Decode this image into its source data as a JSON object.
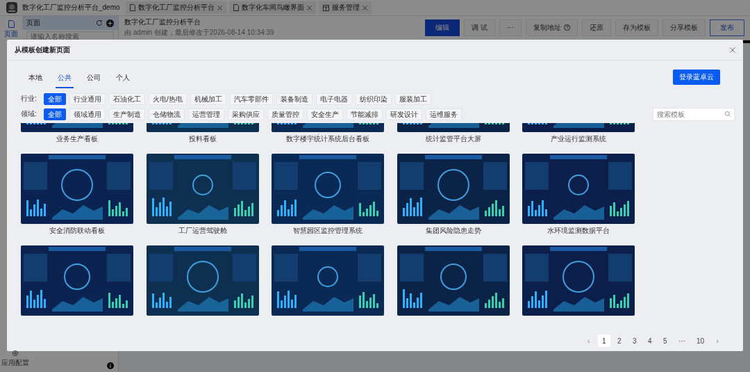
{
  "app_bar": {
    "app_title": "数字化工厂监控分析平台_demo",
    "tabs": [
      {
        "label": "数字化工厂监控分析平台",
        "kind": "page"
      },
      {
        "label": "数字化车间鸟瞰界面",
        "kind": "page"
      },
      {
        "label": "服务管理",
        "kind": "service"
      }
    ]
  },
  "rail": {
    "items": [
      {
        "label": "页面",
        "selected": true
      }
    ],
    "footer": "应用配置"
  },
  "pages_panel": {
    "title": "页面",
    "search_placeholder": "请输入名称搜索"
  },
  "page_header": {
    "title": "数字化工厂监控分析平台",
    "meta": "由 admin 创建，最后修改于2026-08-14 10:34:39"
  },
  "toolbar": [
    {
      "label": "编辑",
      "kind": "primary"
    },
    {
      "label": "调 试",
      "kind": "plain"
    },
    {
      "label": "···",
      "kind": "plain"
    },
    {
      "label": "复制地址",
      "kind": "help"
    },
    {
      "label": "还原",
      "kind": "plain"
    },
    {
      "label": "存为模板",
      "kind": "plain"
    },
    {
      "label": "分享模板",
      "kind": "plain"
    },
    {
      "label": "发布",
      "kind": "outline"
    }
  ],
  "dialog": {
    "title": "从模板创建新页面",
    "tabs": [
      {
        "label": "本地",
        "selected": false
      },
      {
        "label": "公共",
        "selected": true
      },
      {
        "label": "公司",
        "selected": false
      },
      {
        "label": "个人",
        "selected": false
      }
    ],
    "login_button": "登录蓝卓云",
    "filters": [
      {
        "label": "行业:",
        "options": [
          {
            "label": "全部",
            "selected": true
          },
          {
            "label": "行业通用",
            "selected": false
          },
          {
            "label": "石油化工",
            "selected": false
          },
          {
            "label": "火电/热电",
            "selected": false
          },
          {
            "label": "机械加工",
            "selected": false
          },
          {
            "label": "汽车零部件",
            "selected": false
          },
          {
            "label": "装备制造",
            "selected": false
          },
          {
            "label": "电子电器",
            "selected": false
          },
          {
            "label": "纺织印染",
            "selected": false
          },
          {
            "label": "服装加工",
            "selected": false
          }
        ]
      },
      {
        "label": "领域:",
        "options": [
          {
            "label": "全部",
            "selected": true
          },
          {
            "label": "领域通用",
            "selected": false
          },
          {
            "label": "生产制造",
            "selected": false
          },
          {
            "label": "仓储物流",
            "selected": false
          },
          {
            "label": "运营管理",
            "selected": false
          },
          {
            "label": "采购供应",
            "selected": false
          },
          {
            "label": "质量管控",
            "selected": false
          },
          {
            "label": "安全生产",
            "selected": false
          },
          {
            "label": "节能减排",
            "selected": false
          },
          {
            "label": "研发设计",
            "selected": false
          },
          {
            "label": "运维服务",
            "selected": false
          }
        ]
      }
    ],
    "search_placeholder": "搜索模板",
    "templates": [
      {
        "kind": "dashboard",
        "label": "业务生产看板"
      },
      {
        "kind": "dashboard",
        "label": "投料看板"
      },
      {
        "kind": "dashboard",
        "label": "数字楼宇统计系统后台看板"
      },
      {
        "kind": "dashboard",
        "label": "统计监管平台大屏"
      },
      {
        "kind": "dashboard",
        "label": "产业运行监测系统"
      },
      {
        "kind": "dashboard",
        "label": "安全消防联动看板"
      },
      {
        "kind": "dashboard",
        "label": "工厂运营驾驶舱"
      },
      {
        "kind": "dashboard",
        "label": "智慧园区监控管理系统"
      },
      {
        "kind": "dashboard",
        "label": "集团风险隐患走势"
      },
      {
        "kind": "dashboard",
        "label": "水环境监测数据平台"
      },
      {
        "kind": "dashboard"
      },
      {
        "kind": "dashboard"
      },
      {
        "kind": "dashboard"
      },
      {
        "kind": "dashboard"
      },
      {
        "kind": "dashboard"
      }
    ],
    "pagination": {
      "prev": "‹",
      "pages": [
        {
          "label": "1",
          "selected": true
        },
        {
          "label": "2",
          "selected": false
        },
        {
          "label": "3",
          "selected": false
        },
        {
          "label": "4",
          "selected": false
        },
        {
          "label": "5",
          "selected": false
        },
        {
          "label": "···",
          "selected": false
        },
        {
          "label": "10",
          "selected": false
        }
      ],
      "next": "›"
    }
  }
}
